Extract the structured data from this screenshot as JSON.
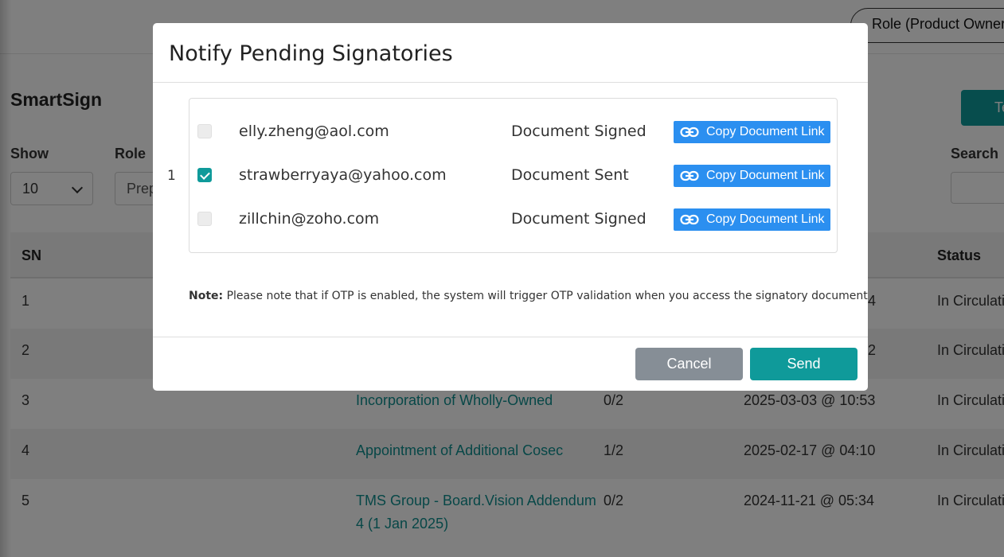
{
  "header": {
    "role_pill": "Role (Product Owner)"
  },
  "app": {
    "title": "SmartSign",
    "top_button": "Te"
  },
  "filters": {
    "show_label": "Show",
    "show_value": "10",
    "role_label": "Role",
    "role_value": "Prep",
    "search_label": "Search"
  },
  "table": {
    "headers": {
      "sn": "SN",
      "status": "Status"
    },
    "rows": [
      {
        "sn": "1",
        "title": "",
        "signed": "",
        "date": "4",
        "status": "In Circulati"
      },
      {
        "sn": "2",
        "title": "",
        "signed": "",
        "date": "2",
        "status": "In Circulati"
      },
      {
        "sn": "3",
        "title": "Incorporation of Wholly-Owned",
        "signed": "0/2",
        "date": "2025-03-03 @ 10:53",
        "status": "In Circulati"
      },
      {
        "sn": "4",
        "title": "Appointment of Additional Cosec",
        "signed": "1/2",
        "date": "2025-02-17 @ 04:10",
        "status": "In Circulati"
      },
      {
        "sn": "5",
        "title": "TMS Group - Board.Vision Addendum",
        "title_line2": "4 (1 Jan 2025)",
        "signed": "0/2",
        "date": "2024-11-21 @ 05:34",
        "status": "In Circulati"
      }
    ]
  },
  "modal": {
    "title": "Notify Pending Signatories",
    "row_index": "1",
    "signatories": [
      {
        "email": "elly.zheng@aol.com",
        "status": "Document Signed",
        "checked": false,
        "copy_label": "Copy Document Link"
      },
      {
        "email": "strawberryaya@yahoo.com",
        "status": "Document Sent",
        "checked": true,
        "copy_label": "Copy Document Link"
      },
      {
        "email": "zillchin@zoho.com",
        "status": "Document Signed",
        "checked": false,
        "copy_label": "Copy Document Link"
      }
    ],
    "note_label": "Note:",
    "note_text": " Please note that if OTP is enabled, the system will trigger OTP validation when you access the signatory document link.",
    "cancel_label": "Cancel",
    "send_label": "Send"
  },
  "colors": {
    "accent": "#0f9a9a",
    "link_button": "#2b8ff0",
    "cancel_button": "#868e96"
  }
}
